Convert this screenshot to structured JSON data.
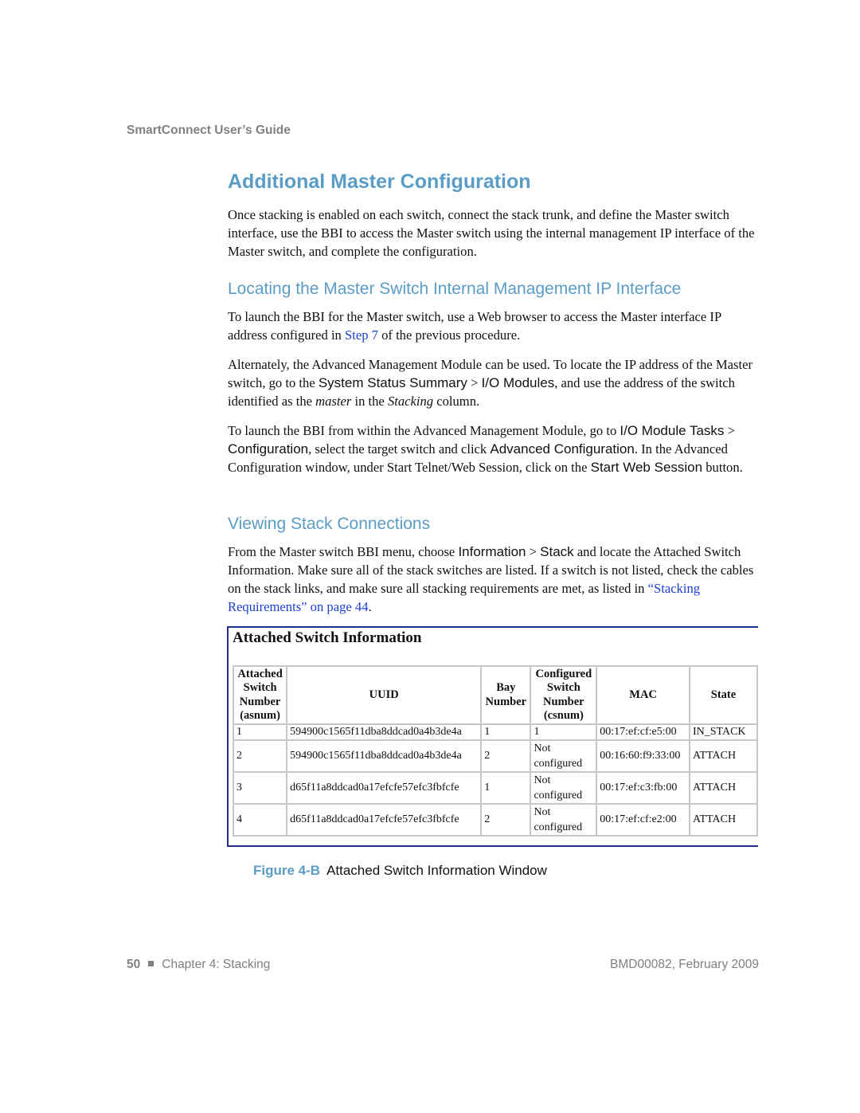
{
  "running_header": "SmartConnect User’s Guide",
  "section_title": "Additional Master Configuration",
  "intro": [
    {
      "t": "Once stacking is enabled on each switch, connect the stack trunk, and define the Master switch interface, use the BBI to access the Master switch using the internal management IP interface of the Master switch, and complete the configuration."
    }
  ],
  "sub1_title": "Locating the Master Switch Internal Management IP Interface",
  "p1": [
    {
      "t": "To launch the BBI for the Master switch, use a Web browser to access the Master interface IP address configured in "
    },
    {
      "t": "Step 7",
      "s": "link"
    },
    {
      "t": " of the previous procedure."
    }
  ],
  "p2": [
    {
      "t": "Alternately, the Advanced Management Module can be used. To locate the IP address of the Master switch, go to the "
    },
    {
      "t": "System Status Summary",
      "s": "ui"
    },
    {
      "t": " > "
    },
    {
      "t": "I/O Modules",
      "s": "ui"
    },
    {
      "t": ", and use the address of the switch identified as the "
    },
    {
      "t": "master",
      "s": "it"
    },
    {
      "t": " in the "
    },
    {
      "t": "Stacking",
      "s": "it"
    },
    {
      "t": " column."
    }
  ],
  "p3": [
    {
      "t": "To launch the BBI from within the Advanced Management Module, go to "
    },
    {
      "t": "I/O Module Tasks",
      "s": "ui"
    },
    {
      "t": " > "
    },
    {
      "t": "Configuration",
      "s": "ui"
    },
    {
      "t": ", select the target switch and click "
    },
    {
      "t": "Advanced Configuration",
      "s": "ui"
    },
    {
      "t": ". In the Advanced Configuration window, under Start Telnet/Web Session, click on the "
    },
    {
      "t": "Start Web Session",
      "s": "ui"
    },
    {
      "t": " button."
    }
  ],
  "sub2_title": "Viewing Stack Connections",
  "p4": [
    {
      "t": "From the Master switch BBI menu, choose "
    },
    {
      "t": "Information",
      "s": "ui"
    },
    {
      "t": " > "
    },
    {
      "t": "Stack",
      "s": "ui"
    },
    {
      "t": " and locate the Attached Switch Information. Make sure all of the stack switches are listed. If a switch is not listed, check the cables on the stack links, and make sure all stacking requirements are met, as listed in "
    },
    {
      "t": "“Stacking Requirements” on page 44",
      "s": "link"
    },
    {
      "t": "."
    }
  ],
  "figure": {
    "window_title": "Attached Switch Information",
    "columns": [
      "Attached Switch Number (asnum)",
      "UUID",
      "Bay Number",
      "Configured Switch Number (csnum)",
      "MAC",
      "State"
    ],
    "rows": [
      [
        "1",
        "594900c1565f11dba8ddcad0a4b3de4a",
        "1",
        "1",
        "00:17:ef:cf:e5:00",
        "IN_STACK"
      ],
      [
        "2",
        "594900c1565f11dba8ddcad0a4b3de4a",
        "2",
        "Not configured",
        "00:16:60:f9:33:00",
        "ATTACH"
      ],
      [
        "3",
        "d65f11a8ddcad0a17efcfe57efc3fbfcfe",
        "1",
        "Not configured",
        "00:17:ef:c3:fb:00",
        "ATTACH"
      ],
      [
        "4",
        "d65f11a8ddcad0a17efcfe57efc3fbfcfe",
        "2",
        "Not configured",
        "00:17:ef:cf:e2:00",
        "ATTACH"
      ]
    ],
    "caption_number": "Figure 4-B",
    "caption_text": "Attached Switch Information Window"
  },
  "footer": {
    "page": "50",
    "chapter": "Chapter 4: Stacking",
    "doc": "BMD00082, February 2009"
  },
  "colors": {
    "heading": "#5a9cc5",
    "link": "#1a3fd0",
    "window_border": "#1f2f8f"
  }
}
